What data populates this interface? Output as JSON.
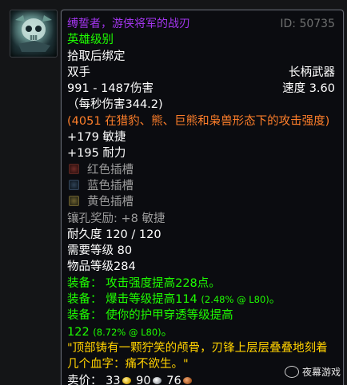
{
  "item": {
    "name": "缚誓者，游侠将军的战刃",
    "id_text": "ID: 50735",
    "quality": "英雄级别",
    "binding": "拾取后绑定",
    "slot": "双手",
    "type": "长柄武器",
    "damage": "991 - 1487伤害",
    "speed": "速度 3.60",
    "dps": "（每秒伤害344.2)",
    "feral_ap": "(4051 在猎豹、熊、巨熊和枭兽形态下的攻击强度)",
    "stat_agi": "+179 敏捷",
    "stat_sta": "+195 耐力",
    "sockets": [
      {
        "label": "红色插槽",
        "color": "red"
      },
      {
        "label": "蓝色插槽",
        "color": "blue"
      },
      {
        "label": "黄色插槽",
        "color": "yellow"
      }
    ],
    "socket_bonus": "镶孔奖励: +8 敏捷",
    "durability": "耐久度 120 / 120",
    "req_level": "需要等级 80",
    "item_level": "物品等级284",
    "equip": [
      {
        "prefix": "装备：",
        "text": "攻击强度提高228点。",
        "note": ""
      },
      {
        "prefix": "装备：",
        "text": "爆击等级提高114 ",
        "note": "(2.48% @ L80)",
        "suffix": "。"
      },
      {
        "prefix": "装备：",
        "text": "使你的护甲穿透等级提高",
        "note": ""
      }
    ],
    "equip3_cont": "122 ",
    "equip3_note": "(8.72% @ L80)",
    "equip3_suffix": "。",
    "flavor_1": "\"顶部铸有一颗狞笑的颅骨，刃锋上层层叠叠地刻着",
    "flavor_2": "几个血字：痛不欲生。\"",
    "sell_label": "卖价：",
    "sell_gold": "33",
    "sell_silver": "90",
    "sell_copper": "76"
  },
  "watermark": "夜幕游戏",
  "icons": {
    "item_icon": "polearm-skull-icon",
    "gold": "gold-coin-icon",
    "silver": "silver-coin-icon",
    "copper": "copper-coin-icon"
  },
  "colors": {
    "epic": "#a335ee",
    "uncommon": "#1eff00",
    "orange": "#ff7f2a",
    "flavor": "#ffd100",
    "gray": "#9d9d9d"
  }
}
